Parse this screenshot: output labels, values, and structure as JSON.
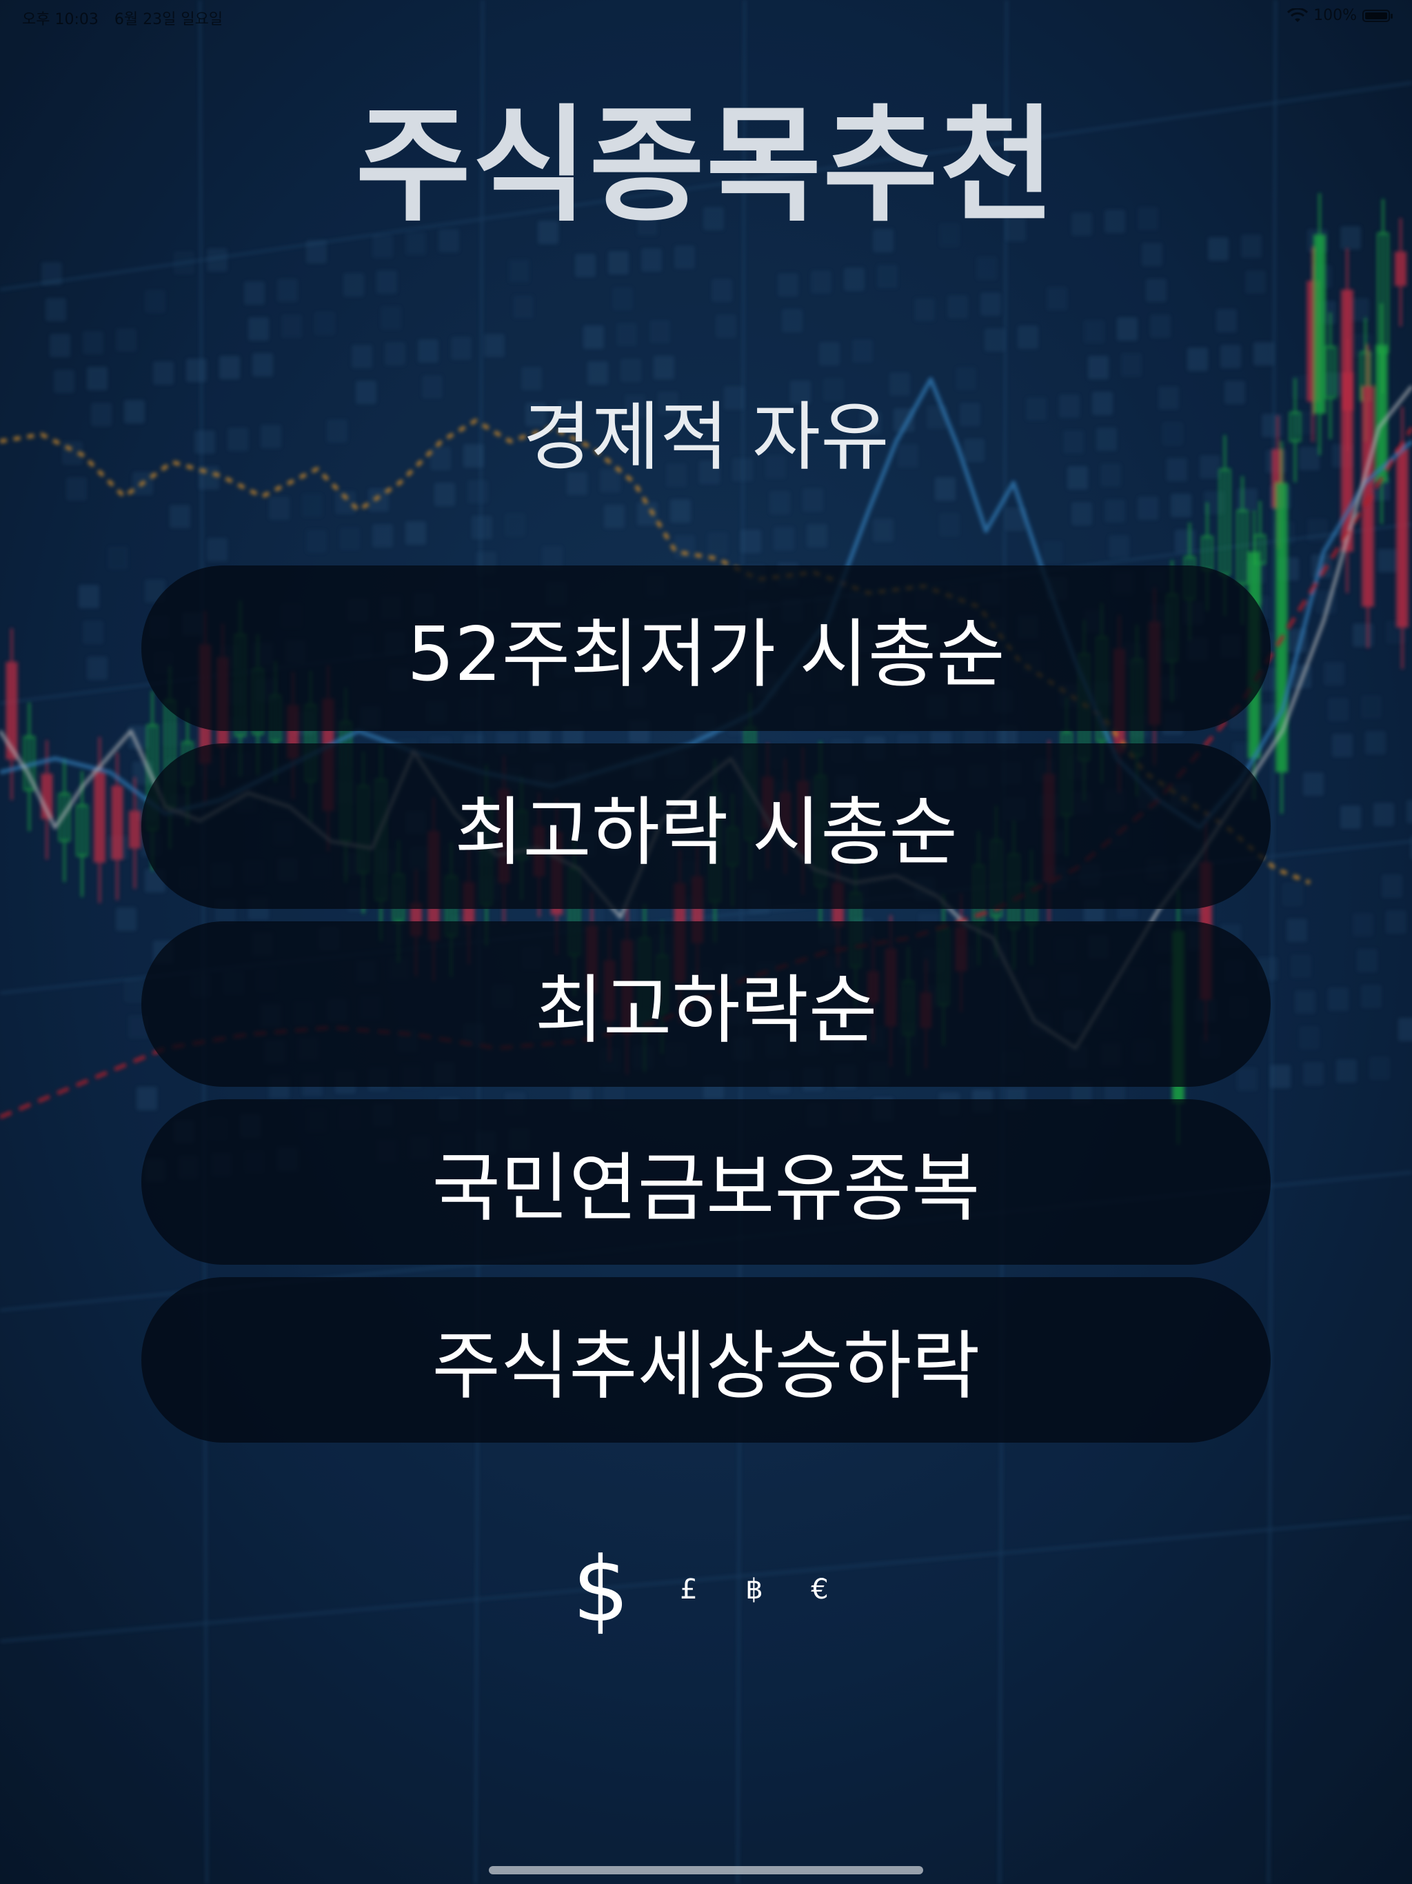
{
  "status_bar": {
    "time": "오후 10:03",
    "date": "6월 23일 일요일",
    "battery": "100%"
  },
  "header": {
    "title": "주식종목추천",
    "subtitle": "경제적 자유"
  },
  "menu": {
    "items": [
      {
        "label": "52주최저가 시총순"
      },
      {
        "label": "최고하락 시총순"
      },
      {
        "label": "최고하락순"
      },
      {
        "label": "국민연금보유종복"
      },
      {
        "label": "주식추세상승하락"
      }
    ]
  },
  "currencies": [
    "$",
    "£",
    "฿",
    "€"
  ],
  "colors": {
    "background": "#0b1f38",
    "button": "#030a14",
    "candle_up": "#22c94a",
    "candle_down": "#e0304a",
    "line_orange": "#e89a2a",
    "line_blue": "#3a8fd0",
    "line_white": "#d8d8d8",
    "line_red": "#d0202a"
  }
}
